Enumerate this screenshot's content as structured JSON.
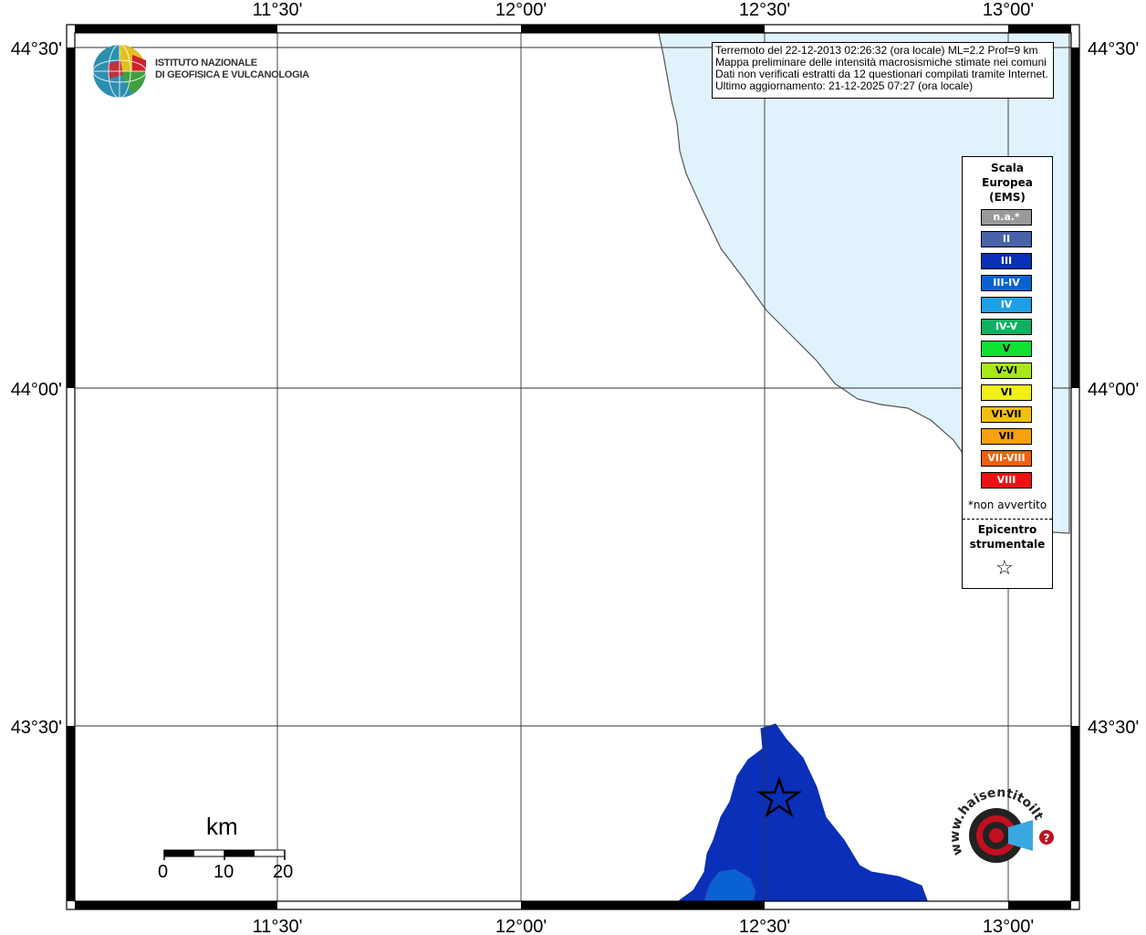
{
  "map": {
    "top_labels": [
      "11°30'",
      "12°00'",
      "12°30'",
      "13°00'"
    ],
    "bottom_labels": [
      "11°30'",
      "12°00'",
      "12°30'",
      "13°00'"
    ],
    "left_labels": [
      "44°30'",
      "44°00'",
      "43°30'"
    ],
    "right_labels": [
      "44°30'",
      "44°00'",
      "43°30'"
    ]
  },
  "logo": {
    "line1": "ISTITUTO NAZIONALE",
    "line2": "DI GEOFISICA E VULCANOLOGIA"
  },
  "info": {
    "line1": "Terremoto del 22-12-2013 02:26:32 (ora locale) ML=2.2 Prof=9 km",
    "line2": "Mappa preliminare delle intensità macrosismiche stimate nei comuni",
    "line3": "Dati non verificati estratti da 12 questionari compilati tramite Internet.",
    "line4": "Ultimo aggiornamento: 21-12-2025 07:27 (ora locale)"
  },
  "legend": {
    "title1": "Scala",
    "title2": "Europea",
    "title3": "(EMS)",
    "items": [
      {
        "label": "n.a.*",
        "color": "#9a9a9a"
      },
      {
        "label": "II",
        "color": "#4a63a8"
      },
      {
        "label": "III",
        "color": "#0a2fb8"
      },
      {
        "label": "III-IV",
        "color": "#0a62d2"
      },
      {
        "label": "IV",
        "color": "#1ea0e8"
      },
      {
        "label": "IV-V",
        "color": "#10b060"
      },
      {
        "label": "V",
        "color": "#10e030"
      },
      {
        "label": "V-VI",
        "color": "#a8e818"
      },
      {
        "label": "VI",
        "color": "#f0f018"
      },
      {
        "label": "VI-VII",
        "color": "#f0c010"
      },
      {
        "label": "VII",
        "color": "#f8a010"
      },
      {
        "label": "VII-VIII",
        "color": "#f06010"
      },
      {
        "label": "VIII",
        "color": "#f01010"
      }
    ],
    "note": "*non avvertito",
    "epicentro1": "Epicentro",
    "epicentro2": "strumentale",
    "star": "☆"
  },
  "scale": {
    "unit": "km",
    "ticks": [
      "0",
      "10",
      "20"
    ]
  },
  "watermark": "www.haisentitoilterremoto.it",
  "colors": {
    "sea": "#e0f2fc",
    "intensity_III": "#0a2fb8",
    "intensity_III_IV": "#0a62d2"
  }
}
